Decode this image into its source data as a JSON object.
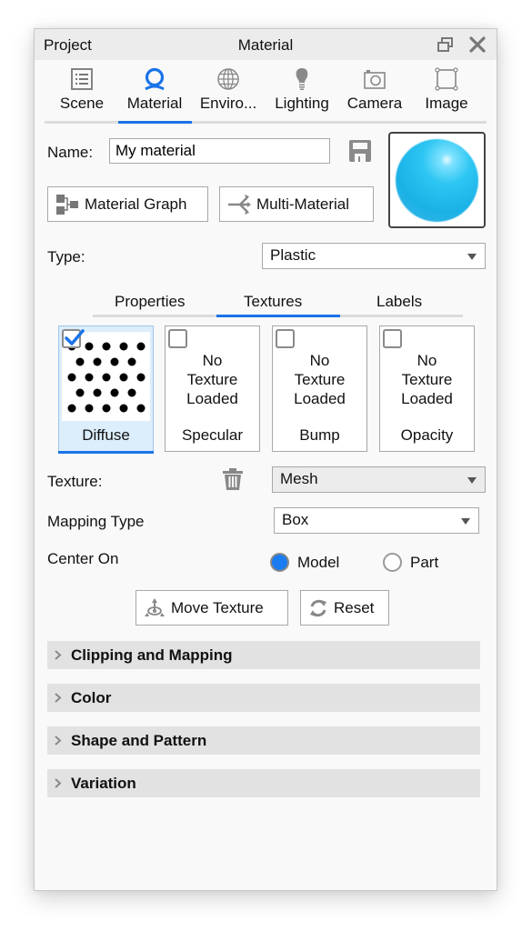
{
  "window": {
    "left_title": "Project",
    "center_title": "Material",
    "restore_icon": "restore-window-icon",
    "close_icon": "close-icon"
  },
  "toolbar": {
    "items": [
      {
        "label": "Scene",
        "icon": "list-icon",
        "active": false
      },
      {
        "label": "Material",
        "icon": "material-icon",
        "active": true
      },
      {
        "label": "Enviro...",
        "icon": "globe-icon",
        "active": false
      },
      {
        "label": "Lighting",
        "icon": "lightbulb-icon",
        "active": false
      },
      {
        "label": "Camera",
        "icon": "camera-icon",
        "active": false
      },
      {
        "label": "Image",
        "icon": "image-frame-icon",
        "active": false
      }
    ]
  },
  "name": {
    "label": "Name:",
    "value": "My material"
  },
  "buttons": {
    "material_graph": "Material Graph",
    "multi_material": "Multi-Material",
    "move_texture": "Move Texture",
    "reset": "Reset"
  },
  "type": {
    "label": "Type:",
    "value": "Plastic"
  },
  "subtabs": {
    "items": [
      {
        "label": "Properties",
        "active": false
      },
      {
        "label": "Textures",
        "active": true
      },
      {
        "label": "Labels",
        "active": false
      }
    ]
  },
  "textures": {
    "empty_text": "No Texture Loaded",
    "cards": [
      {
        "name": "Diffuse",
        "checked": true,
        "loaded": true
      },
      {
        "name": "Specular",
        "checked": false,
        "loaded": false
      },
      {
        "name": "Bump",
        "checked": false,
        "loaded": false
      },
      {
        "name": "Opacity",
        "checked": false,
        "loaded": false
      }
    ]
  },
  "texture_row": {
    "label": "Texture:",
    "value": "Mesh"
  },
  "mapping": {
    "label": "Mapping Type",
    "value": "Box"
  },
  "center_on": {
    "label": "Center On",
    "options": [
      {
        "label": "Model",
        "selected": true
      },
      {
        "label": "Part",
        "selected": false
      }
    ]
  },
  "sections": [
    "Clipping and Mapping",
    "Color",
    "Shape and Pattern",
    "Variation"
  ],
  "colors": {
    "accent": "#1a73e8",
    "sphere": "#1ab1e6",
    "section_bg": "#e2e2e2"
  }
}
